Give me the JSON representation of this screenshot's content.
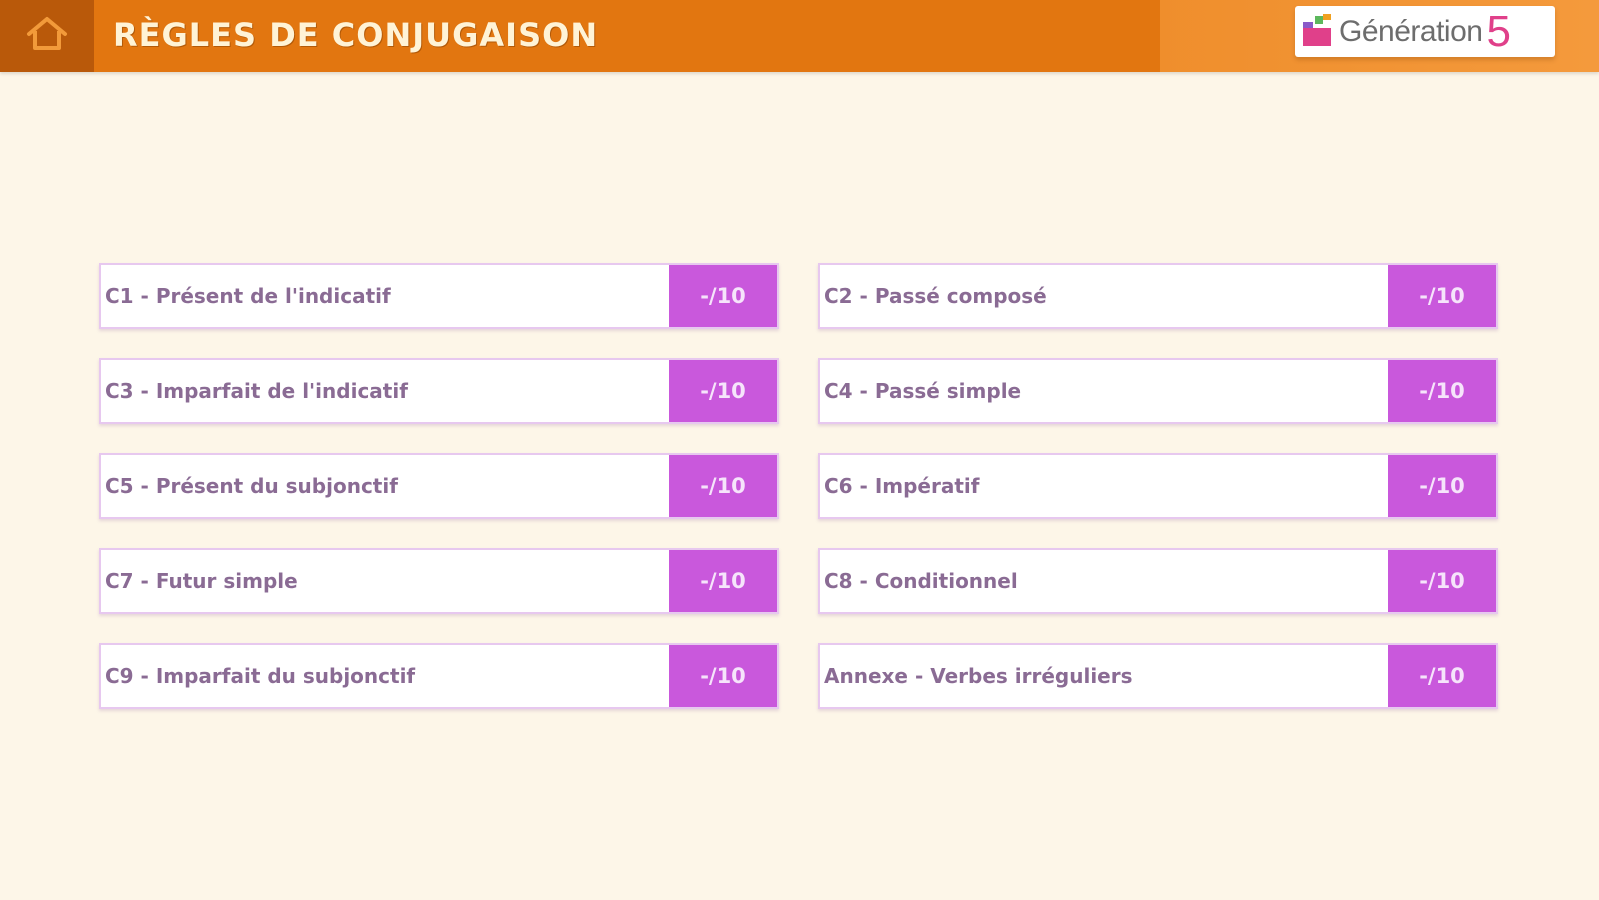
{
  "header": {
    "title": "RÈGLES DE CONJUGAISON",
    "home_icon": "home-icon",
    "logo": {
      "text": "Génération",
      "number": "5"
    }
  },
  "colors": {
    "header_orange": "#e27610",
    "home_dark_orange": "#b9590a",
    "background": "#fdf6e8",
    "score_purple": "#c958dc",
    "label_text": "#8a6b94",
    "border_lilac": "#e7c8ef"
  },
  "lessons": [
    {
      "label": "C1 - Présent de l'indicatif",
      "score": "-/10"
    },
    {
      "label": "C2 - Passé composé",
      "score": "-/10"
    },
    {
      "label": "C3 - Imparfait de l'indicatif",
      "score": "-/10"
    },
    {
      "label": "C4 - Passé simple",
      "score": "-/10"
    },
    {
      "label": "C5 - Présent du subjonctif",
      "score": "-/10"
    },
    {
      "label": "C6 - Impératif",
      "score": "-/10"
    },
    {
      "label": "C7 - Futur simple",
      "score": "-/10"
    },
    {
      "label": "C8 - Conditionnel",
      "score": "-/10"
    },
    {
      "label": "C9 - Imparfait du subjonctif",
      "score": "-/10"
    },
    {
      "label": "Annexe - Verbes irréguliers",
      "score": "-/10"
    }
  ]
}
